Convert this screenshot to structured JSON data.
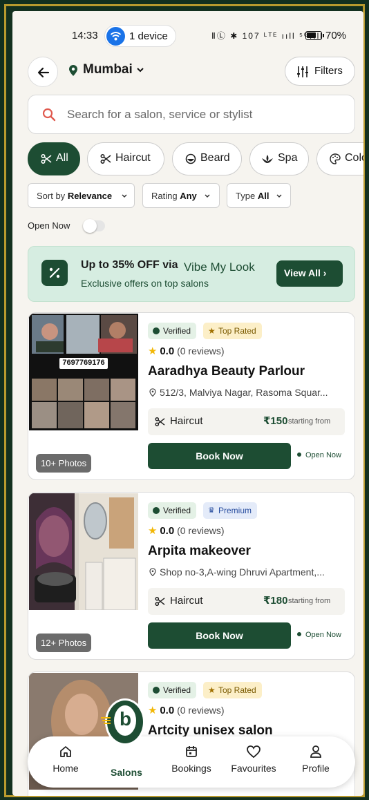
{
  "status_bar": {
    "time": "14:33",
    "device_pill": "1 device",
    "system_icons": "ⅡⓁ ✱ 107 ᴸᵀᴱ ııll ⁵ᴳııll",
    "battery_percent": "70%",
    "battery_level": 0.7
  },
  "header": {
    "location": "Mumbai",
    "filters_label": "Filters"
  },
  "search": {
    "placeholder": "Search for a salon, service or stylist"
  },
  "categories": [
    {
      "label": "All",
      "active": true
    },
    {
      "label": "Haircut",
      "active": false
    },
    {
      "label": "Beard",
      "active": false
    },
    {
      "label": "Spa",
      "active": false
    },
    {
      "label": "Colo",
      "active": false
    }
  ],
  "sort": {
    "sort_prefix": "Sort by",
    "sort_value": "Relevance",
    "rating_prefix": "Rating",
    "rating_value": "Any",
    "type_prefix": "Type",
    "type_value": "All"
  },
  "open_now": {
    "label": "Open Now",
    "on": false
  },
  "offer": {
    "headline": "Up to 35% OFF via",
    "brand": "Vibe My Look",
    "subtext": "Exclusive offers on top salons",
    "cta": "View All ›"
  },
  "salons": [
    {
      "photos": "10+ Photos",
      "photo_phone": "7697769176",
      "verified": "Verified",
      "badge": "Top Rated",
      "badge_type": "toprated",
      "rating": "0.0",
      "reviews": "(0 reviews)",
      "name": "Aaradhya Beauty Parlour",
      "address": "512/3, Malviya Nagar, Rasoma Squar...",
      "service": "Haircut",
      "price": "₹150",
      "price_note": "starting from",
      "book": "Book Now",
      "status": "Open Now"
    },
    {
      "photos": "12+ Photos",
      "verified": "Verified",
      "badge": "Premium",
      "badge_type": "premium",
      "rating": "0.0",
      "reviews": "(0 reviews)",
      "name": "Arpita makeover",
      "address": "Shop no-3,A-wing Dhruvi Apartment,...",
      "service": "Haircut",
      "price": "₹180",
      "price_note": "starting from",
      "book": "Book Now",
      "status": "Open Now"
    },
    {
      "verified": "Verified",
      "badge": "Top Rated",
      "badge_type": "toprated",
      "rating": "0.0",
      "reviews": "(0 reviews)",
      "name": "Artcity unisex salon"
    }
  ],
  "bottom_nav": {
    "home": "Home",
    "salons": "Salons",
    "bookings": "Bookings",
    "favourites": "Favourites",
    "profile": "Profile"
  },
  "colors": {
    "brand_green": "#1d4d33",
    "frame_gold": "#b89a2e",
    "background": "#f6f4ef",
    "offer_bg": "#d6ede1",
    "star": "#f2b705"
  },
  "icons": [
    "wifi-icon",
    "back-arrow-icon",
    "location-pin-icon",
    "chevron-down-icon",
    "filters-icon",
    "search-icon",
    "scissors-icon",
    "beard-icon",
    "spa-icon",
    "palette-icon",
    "percent-icon",
    "star-icon",
    "crown-icon",
    "map-pin-icon",
    "home-icon",
    "calendar-icon",
    "heart-icon",
    "user-icon"
  ]
}
